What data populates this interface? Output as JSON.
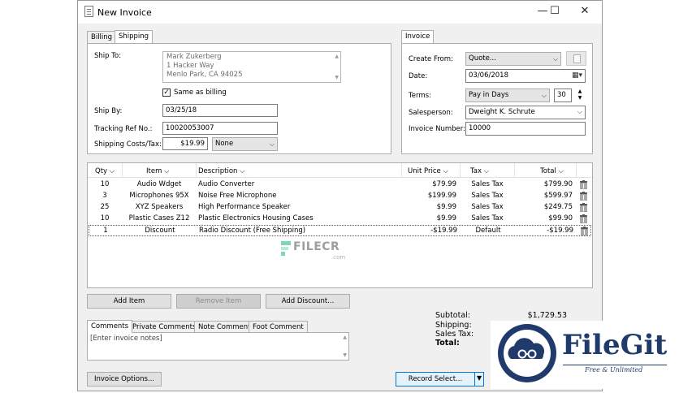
{
  "window": {
    "title": "New Invoice",
    "minimize": "—",
    "maximize": "☐",
    "close": "✕"
  },
  "left_tabs": [
    "Billing",
    "Shipping"
  ],
  "shipping": {
    "ship_to_label": "Ship To:",
    "address_lines": [
      "Mark Zukerberg",
      "1 Hacker Way",
      "Menlo Park, CA 94025"
    ],
    "same_as_billing_label": "Same as billing",
    "same_as_billing_checked": true,
    "ship_by_label": "Ship By:",
    "ship_by_value": "03/25/18",
    "tracking_label": "Tracking Ref No.:",
    "tracking_value": "10020053007",
    "costs_label": "Shipping Costs/Tax:",
    "costs_value": "$19.99",
    "tax_value": "None"
  },
  "invoice_tab": "Invoice",
  "invoice": {
    "create_from_label": "Create From:",
    "create_from_value": "Quote...",
    "date_label": "Date:",
    "date_value": "03/06/2018",
    "terms_label": "Terms:",
    "terms_value": "Pay in Days",
    "terms_days": "30",
    "salesperson_label": "Salesperson:",
    "salesperson_value": "Dweight K. Schrute",
    "invoice_number_label": "Invoice Number:",
    "invoice_number_value": "10000"
  },
  "grid": {
    "headers": {
      "qty": "Qty",
      "item": "Item",
      "description": "Description",
      "unit_price": "Unit Price",
      "tax": "Tax",
      "total": "Total"
    },
    "rows": [
      {
        "qty": "10",
        "item": "Audio Wdget",
        "description": "Audio Converter",
        "unit_price": "$79.99",
        "tax": "Sales Tax",
        "total": "$799.90"
      },
      {
        "qty": "3",
        "item": "Microphones 95X",
        "description": "Noise Free Microphone",
        "unit_price": "$199.99",
        "tax": "Sales Tax",
        "total": "$599.97"
      },
      {
        "qty": "25",
        "item": "XYZ Speakers",
        "description": "High Performance Speaker",
        "unit_price": "$9.99",
        "tax": "Sales Tax",
        "total": "$249.75"
      },
      {
        "qty": "10",
        "item": "Plastic Cases Z12",
        "description": "Plastic Electronics Housing Cases",
        "unit_price": "$9.99",
        "tax": "Sales Tax",
        "total": "$99.90"
      },
      {
        "qty": "1",
        "item": "Discount",
        "description": "Radio Discount (Free Shipping)",
        "unit_price": "-$19.99",
        "tax": "Default",
        "total": "-$19.99"
      }
    ]
  },
  "watermark_center": {
    "text": "FILECR",
    "sub": ".com"
  },
  "buttons": {
    "add_item": "Add Item",
    "remove_item": "Remove Item",
    "add_discount": "Add Discount...",
    "invoice_options": "Invoice Options...",
    "record_select": "Record Select..."
  },
  "notes_tabs": [
    "Comments",
    "Private Comments",
    "Note Comment",
    "Foot Comment"
  ],
  "notes_placeholder": "[Enter invoice notes]",
  "totals": {
    "subtotal_label": "Subtotal:",
    "subtotal_value": "$1,729.53",
    "shipping_label": "Shipping:",
    "sales_tax_label": "Sales Tax:",
    "total_label": "Total:"
  },
  "watermark_badge": {
    "name": "FileGit",
    "tagline": "Free & Unlimited"
  }
}
